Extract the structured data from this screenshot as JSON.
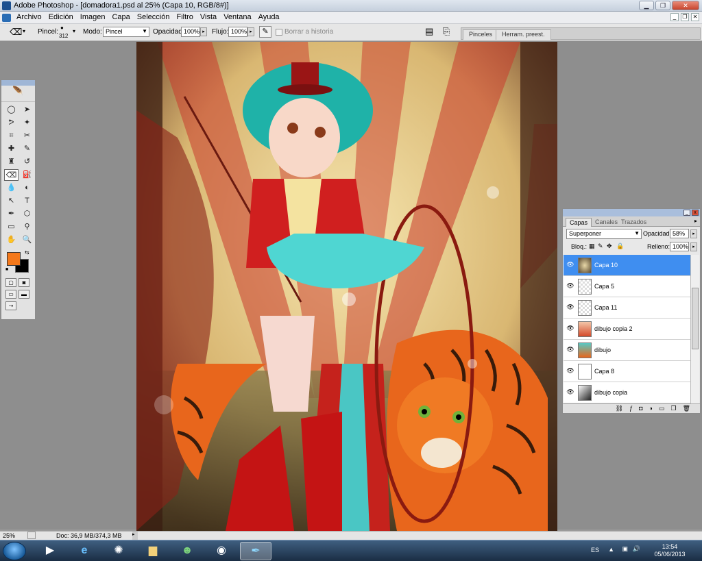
{
  "window": {
    "title": "Adobe Photoshop - [domadora1.psd al 25% (Capa 10, RGB/8#)]",
    "controls": [
      "minimize",
      "maximize",
      "close"
    ]
  },
  "menu": [
    "Archivo",
    "Edición",
    "Imagen",
    "Capa",
    "Selección",
    "Filtro",
    "Vista",
    "Ventana",
    "Ayuda"
  ],
  "options_bar": {
    "brush_label": "Pincel:",
    "brush_size": "312",
    "mode_label": "Modo:",
    "mode_value": "Pincel",
    "opacity_label": "Opacidad:",
    "opacity_value": "100%",
    "flow_label": "Flujo:",
    "flow_value": "100%",
    "erase_history_label": "Borrar a historia",
    "well_tabs": [
      "Pinceles",
      "Herram. preest."
    ]
  },
  "toolbox": {
    "tools": [
      "marquee",
      "move",
      "lasso",
      "magic-wand",
      "crop",
      "slice",
      "healing",
      "brush",
      "stamp",
      "history-brush",
      "eraser",
      "bucket",
      "blur",
      "dodge",
      "path-select",
      "type",
      "pen",
      "shape",
      "notes",
      "eyedropper",
      "hand",
      "zoom"
    ],
    "selected": "eraser",
    "foreground_color": "#f4781a",
    "background_color": "#000000"
  },
  "layers_panel": {
    "tabs": [
      "Capas",
      "Canales",
      "Trazados"
    ],
    "active_tab": "Capas",
    "blend_mode": "Superponer",
    "opacity_label": "Opacidad:",
    "opacity_value": "58%",
    "lock_label": "Bloq.:",
    "fill_label": "Relleno:",
    "fill_value": "100%",
    "layers": [
      {
        "name": "Capa 10",
        "selected": true
      },
      {
        "name": "Capa 5",
        "selected": false
      },
      {
        "name": "Capa 11",
        "selected": false
      },
      {
        "name": "dibujo copia 2",
        "selected": false
      },
      {
        "name": "dibujo",
        "selected": false
      },
      {
        "name": "Capa 8",
        "selected": false
      },
      {
        "name": "dibujo copia",
        "selected": false
      }
    ]
  },
  "status": {
    "zoom": "25%",
    "doc_info": "Doc: 36,9 MB/374,3 MB"
  },
  "taskbar": {
    "apps": [
      "media-player",
      "internet-explorer",
      "wizard",
      "explorer",
      "messenger",
      "chrome",
      "photoshop"
    ],
    "active_app": "photoshop",
    "language": "ES",
    "time": "13:54",
    "date": "05/06/2013"
  }
}
